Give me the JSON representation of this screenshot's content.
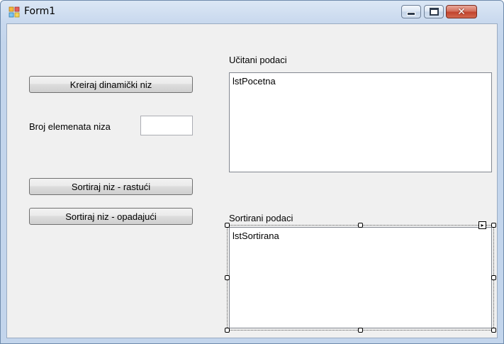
{
  "window": {
    "title": "Form1",
    "close_glyph": "✕"
  },
  "icons": {
    "app": "form-icon",
    "minimize": "minimize-icon",
    "maximize": "maximize-icon",
    "close": "close-icon",
    "smart_tag": "smart-tag-arrow-icon",
    "smart_tag_glyph": "▸"
  },
  "buttons": {
    "create": "Kreiraj dinamički niz",
    "sort_asc": "Sortiraj niz - rastući",
    "sort_desc": "Sortiraj niz - opadajući"
  },
  "array_size": {
    "label": "Broj elemenata niza",
    "value": ""
  },
  "loaded": {
    "label": "Učitani podaci",
    "listbox_name": "lstPocetna"
  },
  "sorted": {
    "label": "Sortirani podaci",
    "listbox_name": "lstSortirana"
  }
}
